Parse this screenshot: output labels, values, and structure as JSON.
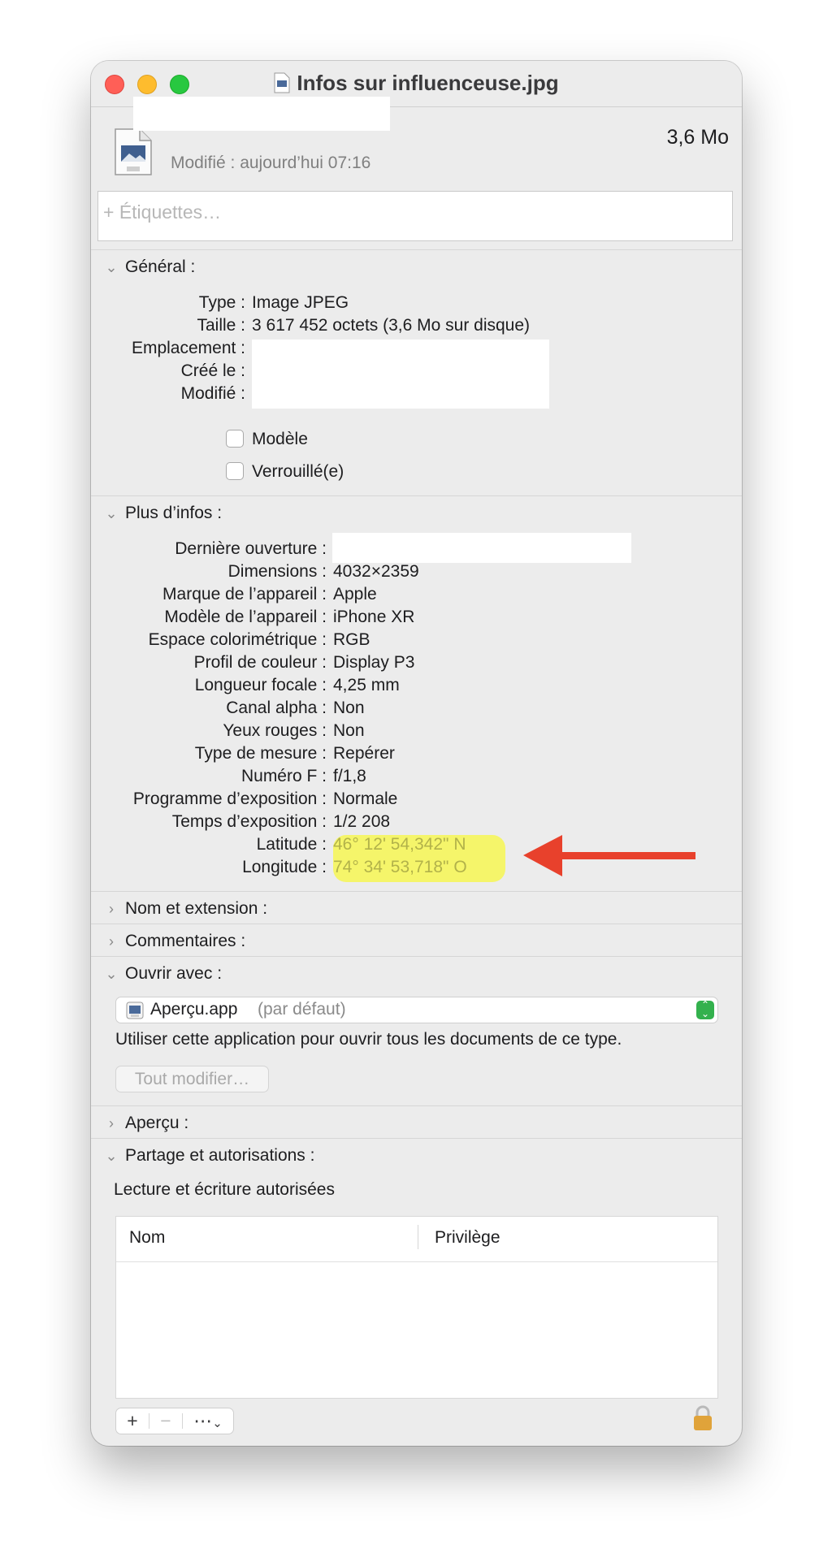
{
  "window": {
    "title": "Infos sur influenceuse.jpg"
  },
  "header": {
    "file_size": "3,6 Mo",
    "modified": "Modifié : aujourd’hui 07:16",
    "tags_placeholder": "+ Étiquettes…"
  },
  "general": {
    "heading": "Général :",
    "rows": [
      {
        "label": "Type :",
        "value": "Image JPEG"
      },
      {
        "label": "Taille :",
        "value": "3 617 452 octets (3,6 Mo sur disque)"
      },
      {
        "label": "Emplacement :",
        "value": ""
      },
      {
        "label": "Créé le :",
        "value": ""
      },
      {
        "label": "Modifié :",
        "value": ""
      }
    ],
    "stationery_label": "Modèle",
    "locked_label": "Verrouillé(e)"
  },
  "more_info": {
    "heading": "Plus d’infos :",
    "rows": [
      {
        "label": "Dernière ouverture :",
        "value": ""
      },
      {
        "label": "Dimensions :",
        "value": "4032×2359"
      },
      {
        "label": "Marque de l’appareil :",
        "value": "Apple"
      },
      {
        "label": "Modèle de l’appareil :",
        "value": "iPhone XR"
      },
      {
        "label": "Espace colorimétrique :",
        "value": "RGB"
      },
      {
        "label": "Profil de couleur :",
        "value": "Display P3"
      },
      {
        "label": "Longueur focale :",
        "value": "4,25 mm"
      },
      {
        "label": "Canal alpha :",
        "value": "Non"
      },
      {
        "label": "Yeux rouges :",
        "value": "Non"
      },
      {
        "label": "Type de mesure :",
        "value": "Repérer"
      },
      {
        "label": "Numéro F :",
        "value": "f/1,8"
      },
      {
        "label": "Programme d’exposition :",
        "value": "Normale"
      },
      {
        "label": "Temps d’exposition :",
        "value": "1/2 208"
      },
      {
        "label": "Latitude :",
        "value": "46° 12' 54,342\" N"
      },
      {
        "label": "Longitude :",
        "value": "74° 34' 53,718\" O"
      }
    ]
  },
  "sections": {
    "name_extension": "Nom et extension :",
    "comments": "Commentaires :",
    "open_with": "Ouvrir avec :",
    "preview": "Aperçu :",
    "sharing": "Partage et autorisations :"
  },
  "open_with": {
    "app": "Aperçu.app",
    "default_suffix": "(par défaut)",
    "hint": "Utiliser cette application pour ouvrir tous les documents de ce type.",
    "change_all": "Tout modifier…"
  },
  "sharing": {
    "status": "Lecture et écriture autorisées",
    "columns": [
      "Nom",
      "Privilège"
    ]
  },
  "toolbar": {
    "add": "+",
    "remove": "−",
    "more": "⋯"
  },
  "colors": {
    "highlight": "#f5f56a",
    "arrow": "#e8412c",
    "coord_text": "#b2b24a"
  }
}
